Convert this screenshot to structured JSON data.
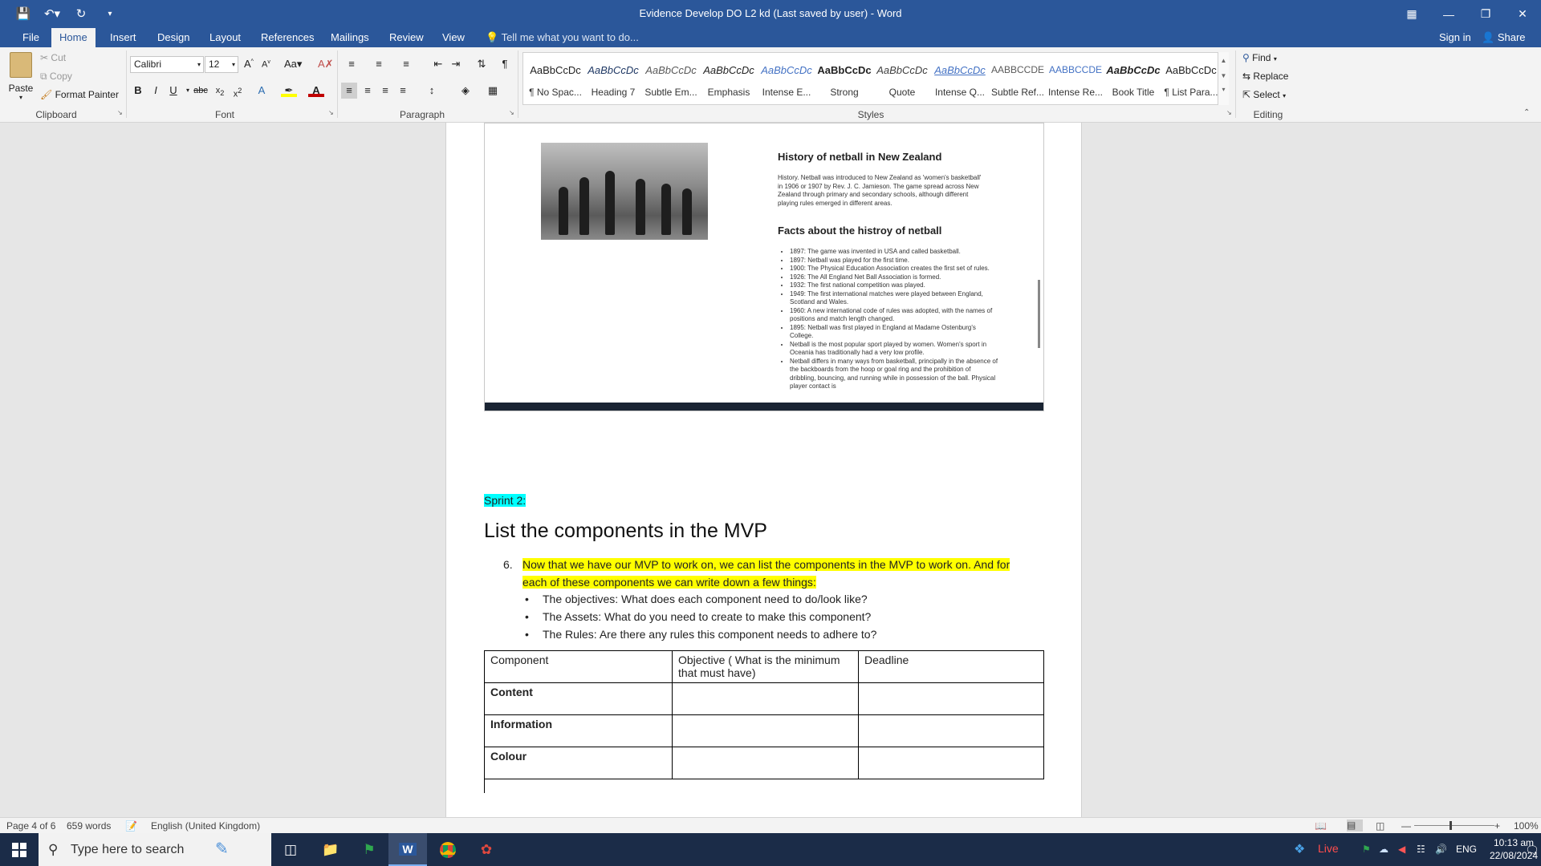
{
  "app": {
    "title": "Evidence Develop DO L2 kd (Last saved by user) - Word"
  },
  "tabs": [
    "File",
    "Home",
    "Insert",
    "Design",
    "Layout",
    "References",
    "Mailings",
    "Review",
    "View"
  ],
  "tell_me": "Tell me what you want to do...",
  "sign_in": "Sign in",
  "share": "Share",
  "clipboard": {
    "paste": "Paste",
    "cut": "Cut",
    "copy": "Copy",
    "format_painter": "Format Painter",
    "label": "Clipboard"
  },
  "font": {
    "family": "Calibri",
    "size": "12",
    "label": "Font"
  },
  "paragraph": {
    "label": "Paragraph"
  },
  "styles": {
    "label": "Styles",
    "items": [
      {
        "sample": "AaBbCcDc",
        "name": "¶ No Spac..."
      },
      {
        "sample": "AaBbCcDc",
        "name": "Heading 7"
      },
      {
        "sample": "AaBbCcDc",
        "name": "Subtle Em..."
      },
      {
        "sample": "AaBbCcDc",
        "name": "Emphasis"
      },
      {
        "sample": "AaBbCcDc",
        "name": "Intense E..."
      },
      {
        "sample": "AaBbCcDc",
        "name": "Strong"
      },
      {
        "sample": "AaBbCcDc",
        "name": "Quote"
      },
      {
        "sample": "AaBbCcDc",
        "name": "Intense Q..."
      },
      {
        "sample": "AABBCCDE",
        "name": "Subtle Ref..."
      },
      {
        "sample": "AABBCCDE",
        "name": "Intense Re..."
      },
      {
        "sample": "AaBbCcDc",
        "name": "Book Title"
      },
      {
        "sample": "AaBbCcDc",
        "name": "¶ List Para..."
      }
    ]
  },
  "editing": {
    "find": "Find",
    "replace": "Replace",
    "select": "Select",
    "label": "Editing"
  },
  "embed": {
    "h1": "History of netball in New Zealand",
    "p": "History. Netball was introduced to New Zealand as 'women's basketball' in 1906 or 1907 by Rev. J. C. Jamieson. The game spread across New Zealand through primary and secondary schools, although different playing rules emerged in different areas.",
    "h2": "Facts about the histroy of netball",
    "facts": [
      "1897: The game was invented in USA and called basketball.",
      "1897: Netball was played for the first time.",
      "1900: The Physical Education Association creates the first set of rules.",
      "1926: The All England Net Ball Association is formed.",
      "1932: The first national competition was played.",
      "1949: The first international matches were played between England, Scotland and Wales.",
      "1960: A new international code of rules was adopted, with the names of positions and match length changed.",
      "1895: Netball was first played in England at Madame Ostenburg's College.",
      "Netball is the most popular sport played by women. Women's sport in Oceania has traditionally had a very low profile.",
      "Netball differs in many ways from basketball, principally in the absence of the backboards from the hoop or goal ring and the prohibition of dribbling, bouncing, and running while in possession of the ball. Physical player contact is"
    ]
  },
  "doc": {
    "sprint": "Sprint 2:",
    "heading": "List the components in the MVP",
    "item_num": "6.",
    "item_text": "Now that we have our MVP to work on, we can list the components in the MVP to work on. And for each of these components we can write down a few things:",
    "bullets": [
      "The objectives: What does each component need to do/look like?",
      "The Assets: What do you need to create to make this component?",
      "The Rules: Are there any rules this component needs to adhere to?"
    ],
    "table": {
      "headers": [
        "Component",
        "Objective ( What is the minimum that must have)",
        "Deadline"
      ],
      "rows": [
        [
          "Content",
          "",
          ""
        ],
        [
          "Information",
          "",
          ""
        ],
        [
          "Colour",
          "",
          ""
        ]
      ]
    }
  },
  "status": {
    "page": "Page 4 of 6",
    "words": "659 words",
    "language": "English (United Kingdom)",
    "zoom": "100%"
  },
  "taskbar": {
    "search_placeholder": "Type here to search",
    "live": "Live",
    "lang": "ENG",
    "time": "10:13 am",
    "date": "22/08/2024"
  },
  "colors": {
    "word_blue": "#2b579a",
    "highlight_cyan": "#00ffff",
    "highlight_yellow": "#ffff00"
  }
}
